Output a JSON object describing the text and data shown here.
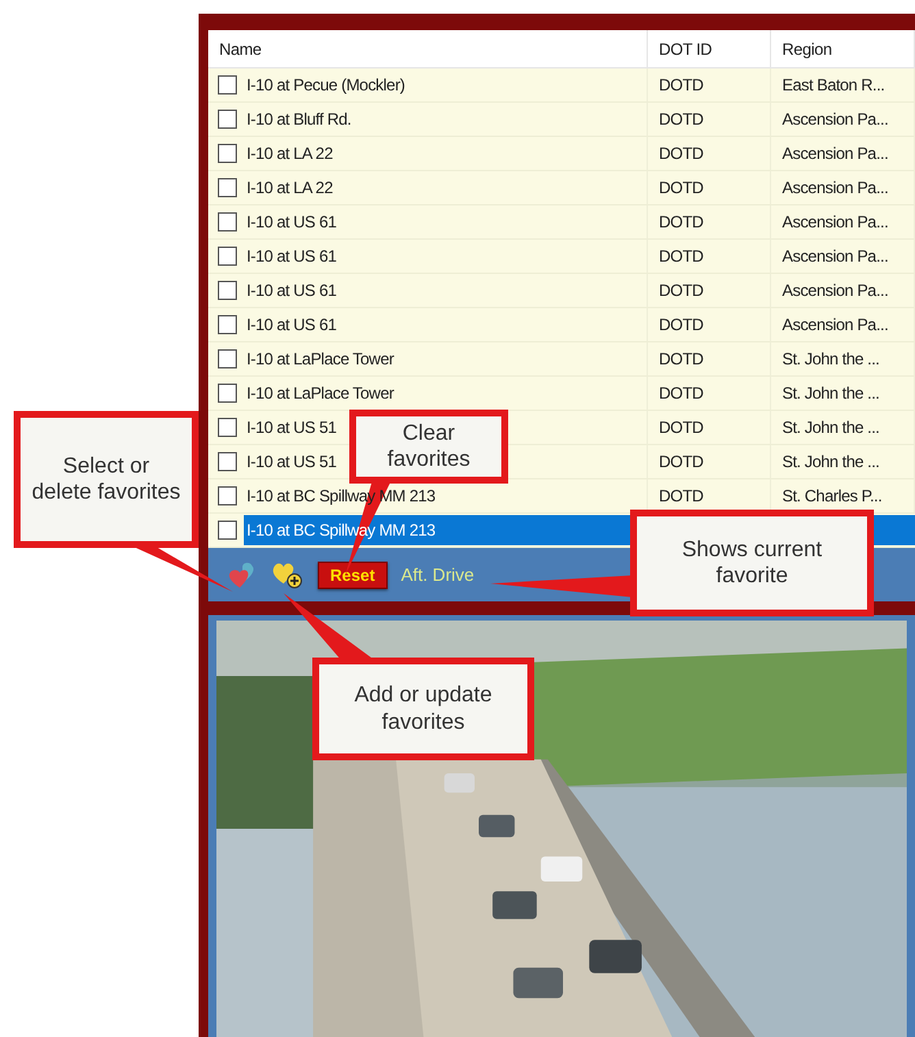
{
  "table": {
    "columns": [
      "Name",
      "DOT ID",
      "Region"
    ],
    "rows": [
      {
        "name": "I-10 at Pecue (Mockler)",
        "dot_id": "DOTD",
        "region": "East Baton R...",
        "checked": false,
        "selected": false
      },
      {
        "name": "I-10 at Bluff Rd.",
        "dot_id": "DOTD",
        "region": "Ascension Pa...",
        "checked": false,
        "selected": false
      },
      {
        "name": "I-10 at LA 22",
        "dot_id": "DOTD",
        "region": "Ascension Pa...",
        "checked": false,
        "selected": false
      },
      {
        "name": "I-10 at LA 22",
        "dot_id": "DOTD",
        "region": "Ascension Pa...",
        "checked": false,
        "selected": false
      },
      {
        "name": "I-10 at US 61",
        "dot_id": "DOTD",
        "region": "Ascension Pa...",
        "checked": false,
        "selected": false
      },
      {
        "name": "I-10 at US 61",
        "dot_id": "DOTD",
        "region": "Ascension Pa...",
        "checked": false,
        "selected": false
      },
      {
        "name": "I-10 at US 61",
        "dot_id": "DOTD",
        "region": "Ascension Pa...",
        "checked": false,
        "selected": false
      },
      {
        "name": "I-10 at US 61",
        "dot_id": "DOTD",
        "region": "Ascension Pa...",
        "checked": false,
        "selected": false
      },
      {
        "name": "I-10 at LaPlace Tower",
        "dot_id": "DOTD",
        "region": "St. John the ...",
        "checked": false,
        "selected": false
      },
      {
        "name": "I-10 at LaPlace Tower",
        "dot_id": "DOTD",
        "region": "St. John the ...",
        "checked": false,
        "selected": false
      },
      {
        "name": "I-10 at US 51",
        "dot_id": "DOTD",
        "region": "St. John the ...",
        "checked": false,
        "selected": false
      },
      {
        "name": "I-10 at US 51",
        "dot_id": "DOTD",
        "region": "St. John the ...",
        "checked": false,
        "selected": false
      },
      {
        "name": "I-10 at BC Spillway MM 213",
        "dot_id": "DOTD",
        "region": "St. Charles P...",
        "checked": false,
        "selected": false
      },
      {
        "name": "I-10 at BC Spillway MM 213",
        "checked": false,
        "selected": true
      }
    ]
  },
  "toolbar": {
    "reset_label": "Reset",
    "current_favorite": "Aft. Drive"
  },
  "callouts": [
    "Select or delete favorites",
    "Clear favorites",
    "Shows current favorite",
    "Add or update favorites"
  ]
}
